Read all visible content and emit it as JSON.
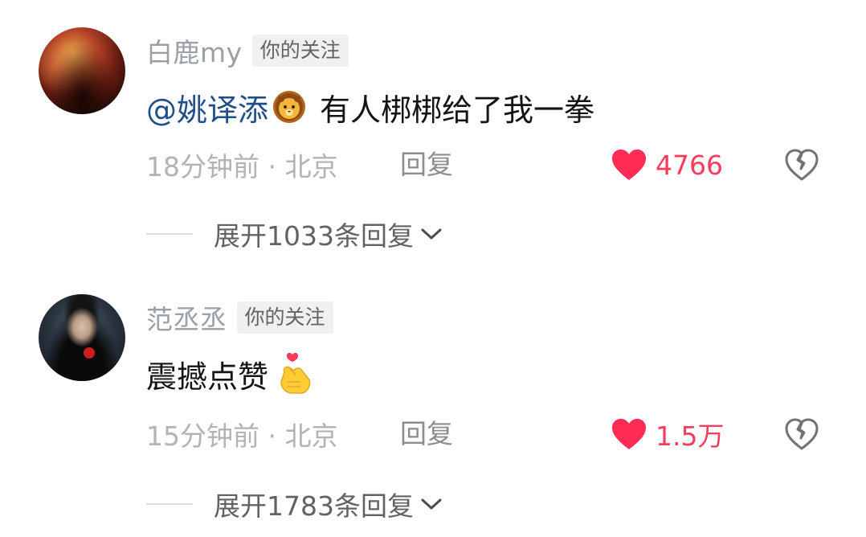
{
  "comments": [
    {
      "username": "白鹿my",
      "follow_tag": "你的关注",
      "mention": "@姚译添",
      "text": "有人梆梆给了我一拳",
      "emoji": "lion-emoji",
      "time_location": "18分钟前 · 北京",
      "reply_label": "回复",
      "likes": "4766",
      "expand_label": "展开1033条回复"
    },
    {
      "username": "范丞丞",
      "follow_tag": "你的关注",
      "text": "震撼点赞",
      "emoji": "finger-heart-emoji",
      "time_location": "15分钟前 · 北京",
      "reply_label": "回复",
      "likes": "1.5万",
      "expand_label": "展开1783条回复"
    }
  ],
  "icons": {
    "like": "heart-icon",
    "dislike": "broken-heart-icon",
    "expand": "chevron-down-icon"
  },
  "colors": {
    "like_red": "#ff3b5c",
    "mention_blue": "#1f4e8a",
    "muted_gray": "#b0b3b8"
  }
}
